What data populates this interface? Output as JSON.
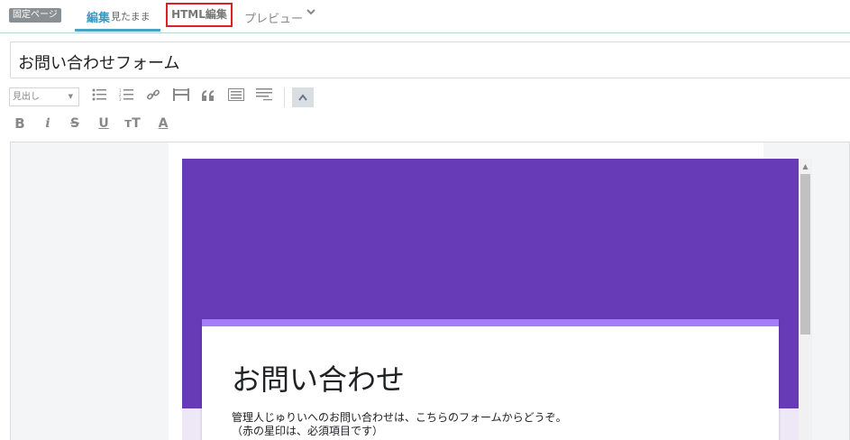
{
  "tabs": {
    "badge": "固定ページ",
    "edit_label": "編集",
    "edit_sub": "見たまま",
    "html_label": "HTML編集",
    "preview_label": "プレビュー"
  },
  "title_input": {
    "value": "お問い合わせフォーム"
  },
  "toolbar": {
    "heading_select": "見出し",
    "icons": [
      "bullet-list",
      "numbered-list",
      "link",
      "more-break",
      "quote",
      "table-of-contents",
      "footnote",
      "collapse-toolbar"
    ],
    "row2": {
      "bold": "B",
      "italic": "i",
      "strike": "S",
      "underline": "U",
      "textsize": "тT",
      "color": "A"
    }
  },
  "form": {
    "title": "お問い合わせ",
    "desc_line1": "管理人じゅりいへのお問い合わせは、こちらのフォームからどうぞ。",
    "desc_line2": "（赤の星印は、必須項目です）",
    "accent_color": "#673ab7"
  }
}
